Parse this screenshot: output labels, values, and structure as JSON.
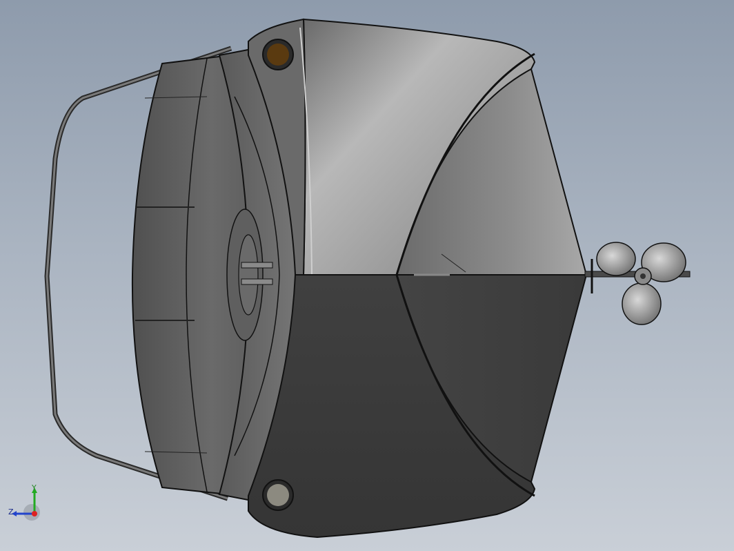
{
  "view": {
    "background_top": "#8e9bac",
    "background_bottom": "#c9cfd7"
  },
  "model": {
    "hull_top_color": "#8a8a8a",
    "hull_bottom_color": "#3a3a3a",
    "edge_color": "#111111",
    "porthole_top_color": "#5a3a10",
    "porthole_bottom_color": "#8c8a80"
  },
  "triad": {
    "y_label": "Y",
    "z_label": "Z",
    "y_color": "#22aa22",
    "z_color": "#2244cc",
    "x_color": "#dd2222"
  }
}
